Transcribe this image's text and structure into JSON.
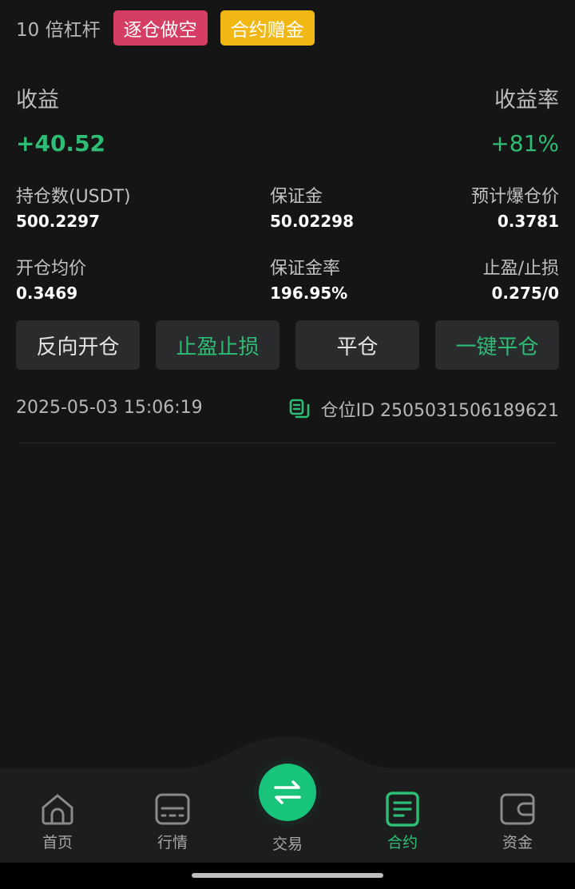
{
  "header": {
    "leverage": "10 倍杠杆",
    "tag_mode": "逐仓做空",
    "tag_bonus": "合约赠金"
  },
  "profit": {
    "label": "收益",
    "value": "+40.52",
    "rate_label": "收益率",
    "rate_value": "+81%"
  },
  "details": {
    "position_label": "持仓数(USDT)",
    "position_value": "500.2297",
    "margin_label": "保证金",
    "margin_value": "50.02298",
    "liq_label": "预计爆仓价",
    "liq_value": "0.3781",
    "open_label": "开仓均价",
    "open_value": "0.3469",
    "margin_rate_label": "保证金率",
    "margin_rate_value": "196.95%",
    "tpsl_label": "止盈/止损",
    "tpsl_value": "0.275/0"
  },
  "actions": {
    "reverse": "反向开仓",
    "tpsl": "止盈止损",
    "close": "平仓",
    "close_all": "一键平仓"
  },
  "info": {
    "time": "2025-05-03 15:06:19",
    "position_id": "仓位ID 2505031506189621"
  },
  "nav": {
    "home": "首页",
    "market": "行情",
    "trade": "交易",
    "contract": "合约",
    "assets": "资金"
  },
  "colors": {
    "accent_green": "#2ebd74",
    "short_tag": "#d63d62",
    "bonus_tag": "#f1b814"
  }
}
